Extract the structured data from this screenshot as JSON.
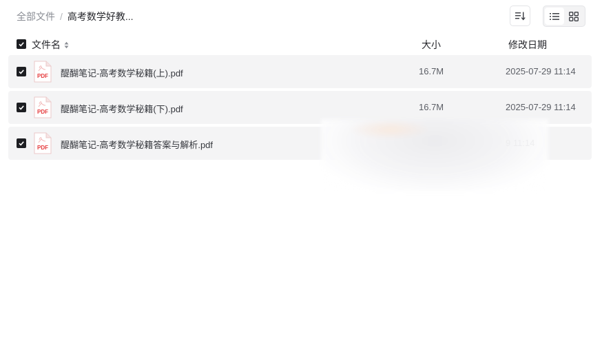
{
  "breadcrumb": {
    "root": "全部文件",
    "separator": "/",
    "current": "高考数学好教..."
  },
  "toolbar": {
    "sort_icon": "sort-icon",
    "list_view_icon": "list-view-icon",
    "grid_view_icon": "grid-view-icon",
    "active_view": "list"
  },
  "header": {
    "name": "文件名",
    "size": "大小",
    "date": "修改日期",
    "all_selected": true
  },
  "files": [
    {
      "name": "醍醐笔记-高考数学秘籍(上).pdf",
      "size": "16.7M",
      "date": "2025-07-29 11:14",
      "checked": true,
      "icon": "pdf-icon",
      "icon_label": "PDF"
    },
    {
      "name": "醍醐笔记-高考数学秘籍(下).pdf",
      "size": "16.7M",
      "date": "2025-07-29 11:14",
      "checked": true,
      "icon": "pdf-icon",
      "icon_label": "PDF"
    },
    {
      "name": "醍醐笔记-高考数学秘籍答案与解析.pdf",
      "size": "",
      "date": "9 11:14",
      "checked": true,
      "icon": "pdf-icon",
      "icon_label": "PDF"
    }
  ],
  "colors": {
    "row_background": "#f4f4f5",
    "checkbox": "#1d1e22",
    "pdf_red": "#e5393b"
  }
}
